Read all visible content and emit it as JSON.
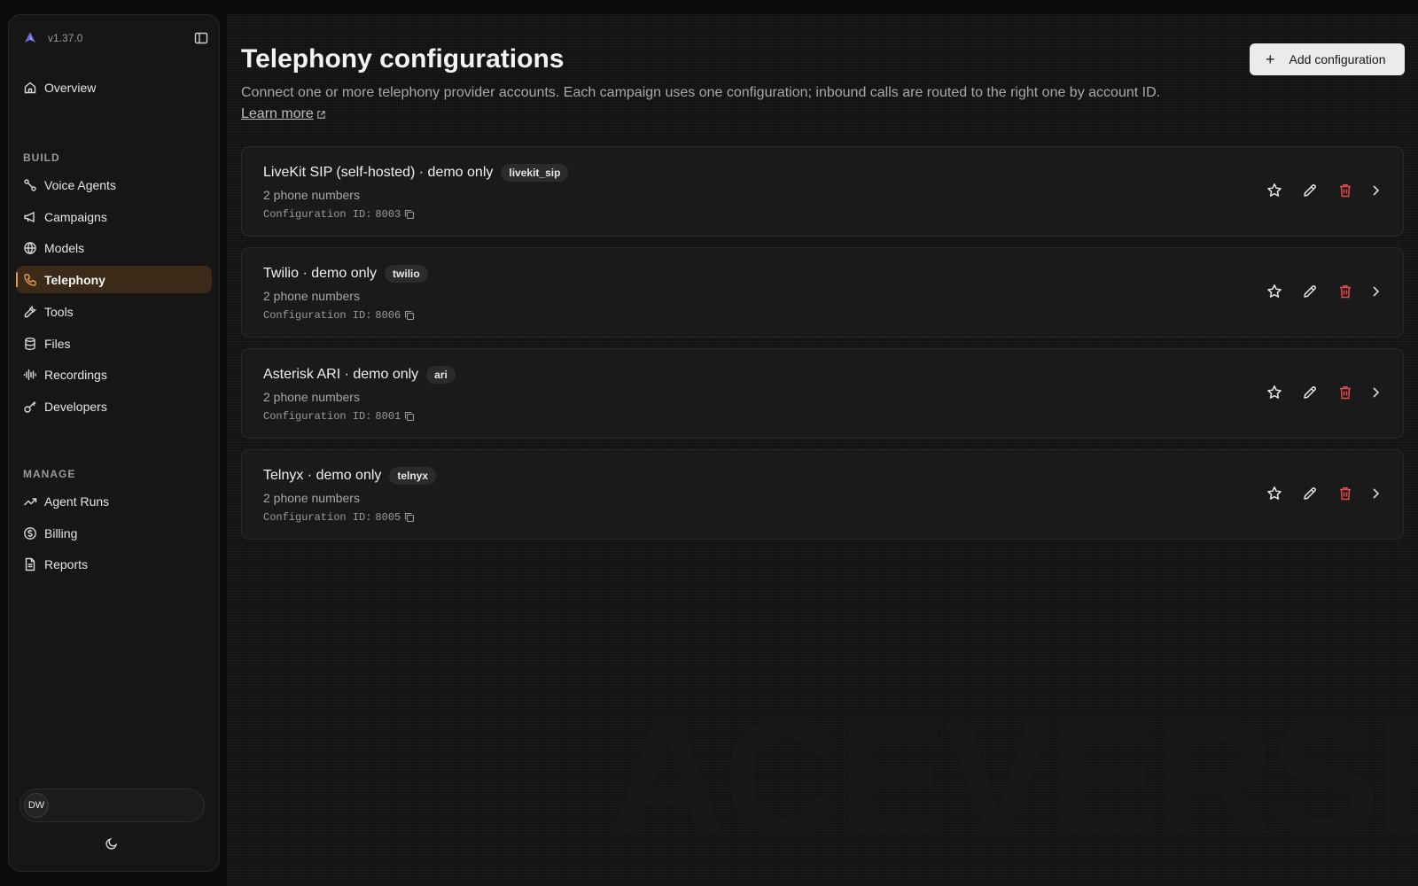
{
  "app": {
    "version": "v1.37.0"
  },
  "sidebar": {
    "top_items": [
      {
        "label": "Overview",
        "icon": "home-icon"
      }
    ],
    "sections": [
      {
        "title": "BUILD",
        "items": [
          {
            "label": "Voice Agents",
            "icon": "route-icon"
          },
          {
            "label": "Campaigns",
            "icon": "megaphone-icon"
          },
          {
            "label": "Models",
            "icon": "globe-icon"
          },
          {
            "label": "Telephony",
            "icon": "phone-icon",
            "active": true
          },
          {
            "label": "Tools",
            "icon": "wrench-icon"
          },
          {
            "label": "Files",
            "icon": "database-icon"
          },
          {
            "label": "Recordings",
            "icon": "audio-waveform-icon"
          },
          {
            "label": "Developers",
            "icon": "key-icon"
          }
        ]
      },
      {
        "title": "MANAGE",
        "items": [
          {
            "label": "Agent Runs",
            "icon": "trending-up-icon"
          },
          {
            "label": "Billing",
            "icon": "dollar-circle-icon"
          },
          {
            "label": "Reports",
            "icon": "file-text-icon"
          }
        ]
      }
    ],
    "user": {
      "initials": "DW"
    }
  },
  "main": {
    "title": "Telephony configurations",
    "description": "Connect one or more telephony provider accounts. Each campaign uses one configuration; inbound calls are routed to the right one by account ID.",
    "learn_more": "Learn more",
    "add_button": "Add configuration",
    "watermark": "ACEVERSE",
    "id_label": "Configuration ID:",
    "configurations": [
      {
        "name": "LiveKit SIP (self-hosted) · demo only",
        "provider": "livekit_sip",
        "phone_numbers": "2 phone numbers",
        "id": "8003"
      },
      {
        "name": "Twilio · demo only",
        "provider": "twilio",
        "phone_numbers": "2 phone numbers",
        "id": "8006"
      },
      {
        "name": "Asterisk ARI · demo only",
        "provider": "ari",
        "phone_numbers": "2 phone numbers",
        "id": "8001"
      },
      {
        "name": "Telnyx · demo only",
        "provider": "telnyx",
        "phone_numbers": "2 phone numbers",
        "id": "8005"
      }
    ]
  },
  "colors": {
    "accent": "#e09a4d",
    "danger": "#e5484d",
    "background": "#121212"
  }
}
